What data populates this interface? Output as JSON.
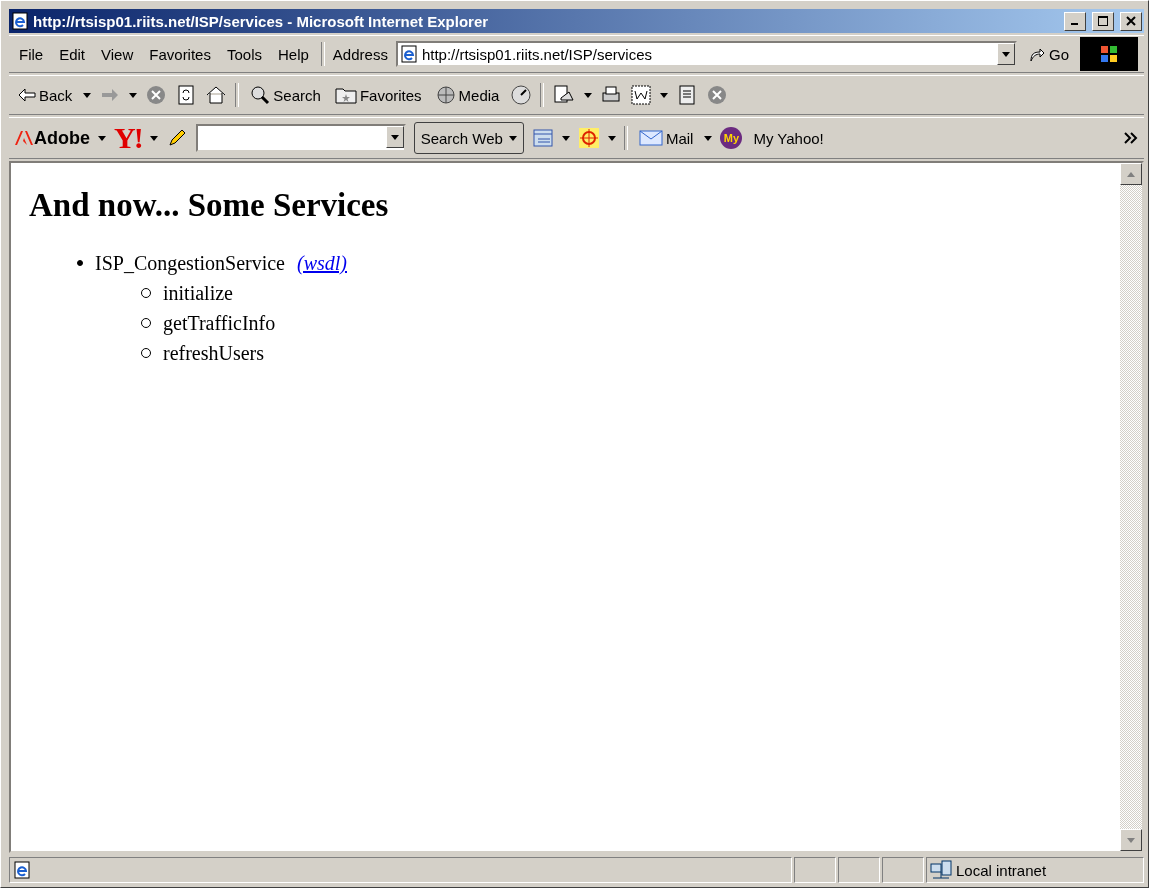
{
  "window": {
    "title": "http://rtsisp01.riits.net/ISP/services - Microsoft Internet Explorer"
  },
  "menu": [
    "File",
    "Edit",
    "View",
    "Favorites",
    "Tools",
    "Help"
  ],
  "address": {
    "label": "Address",
    "value": "http://rtsisp01.riits.net/ISP/services",
    "go": "Go"
  },
  "toolbar": {
    "back": "Back",
    "search": "Search",
    "favorites": "Favorites",
    "media": "Media"
  },
  "links_bar": {
    "adobe": "Adobe",
    "yahoo_logo": "Y!",
    "search_button": "Search Web",
    "mail": "Mail",
    "my_badge": "My",
    "my_yahoo": "My Yahoo!"
  },
  "page": {
    "heading": "And now... Some Services",
    "services": [
      {
        "name": "ISP_CongestionService",
        "link": "(wsdl)",
        "operations": [
          "initialize",
          "getTrafficInfo",
          "refreshUsers"
        ]
      }
    ]
  },
  "status_bar": {
    "zone": "Local intranet"
  }
}
